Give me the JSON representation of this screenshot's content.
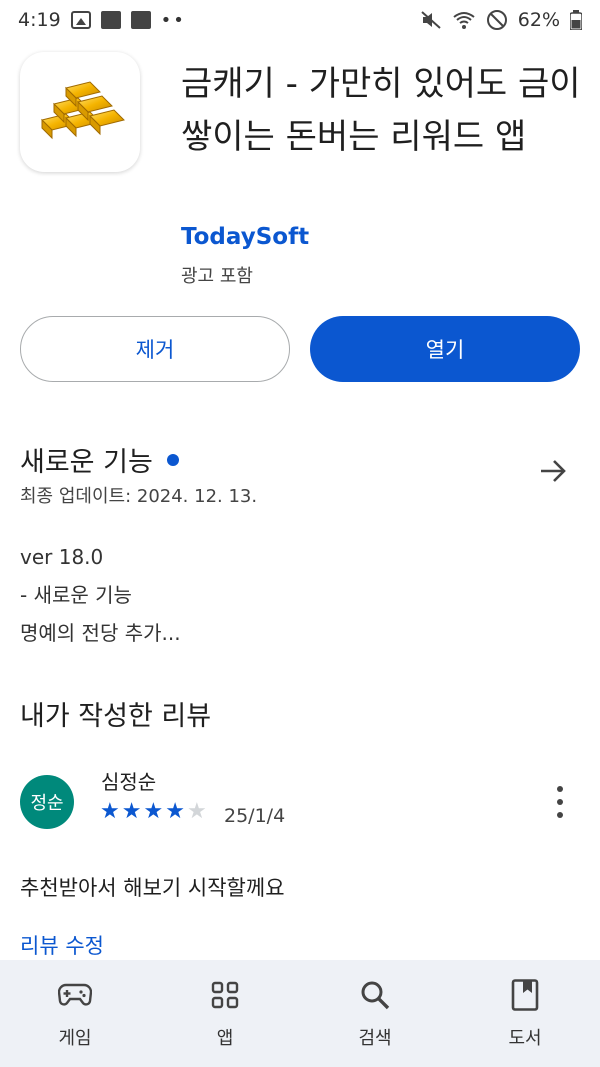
{
  "status_bar": {
    "time": "4:19",
    "battery": "62%"
  },
  "app": {
    "title": "금캐기 - 가만히 있어도 금이 쌓이는 돈버는 리워드 앱",
    "developer": "TodaySoft",
    "ads_note": "광고 포함",
    "icon": "gold-bars-icon"
  },
  "actions": {
    "remove_label": "제거",
    "open_label": "열기"
  },
  "whats_new": {
    "title": "새로운 기능",
    "last_updated": "최종 업데이트: 2024. 12. 13.",
    "notes": [
      "ver 18.0",
      "- 새로운 기능",
      "명예의 전당 추가..."
    ]
  },
  "my_review": {
    "title": "내가 작성한 리뷰",
    "avatar_initials": "정순",
    "reviewer": "심정순",
    "rating": 4,
    "rating_max": 5,
    "date": "25/1/4",
    "text": "추천받아서 해보기 시작할께요",
    "edit_label": "리뷰 수정"
  },
  "bottom_nav": {
    "items": [
      {
        "label": "게임",
        "icon": "gamepad-icon"
      },
      {
        "label": "앱",
        "icon": "apps-grid-icon"
      },
      {
        "label": "검색",
        "icon": "search-icon"
      },
      {
        "label": "도서",
        "icon": "book-icon"
      }
    ]
  },
  "colors": {
    "accent": "#0b57d0",
    "avatar": "#00897b",
    "nav_bg": "#eef1f6"
  }
}
